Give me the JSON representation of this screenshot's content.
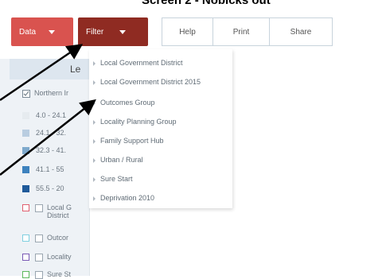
{
  "title": "Screen 2 - Noblcks out",
  "toolbar": {
    "data_label": "Data",
    "filter_label": "Filter",
    "help_label": "Help",
    "print_label": "Print",
    "share_label": "Share"
  },
  "sidebar": {
    "legend_heading": "Le",
    "items": [
      {
        "label": "Northern Ir",
        "kind": "checkbox"
      },
      {
        "label": "4.0 - 24.1",
        "kind": "swatch",
        "color": "#e6ebef"
      },
      {
        "label": "24.1 - 32.",
        "kind": "swatch",
        "color": "#b9cde0"
      },
      {
        "label": "32.3 - 41.",
        "kind": "swatch",
        "color": "#7ea9cc"
      },
      {
        "label": "41.1 - 55",
        "kind": "swatch",
        "color": "#3d82be"
      },
      {
        "label": "55.5 - 20",
        "kind": "swatch",
        "color": "#1f5a9a"
      },
      {
        "label": "Local G District",
        "kind": "boxed",
        "color": "#e06070"
      },
      {
        "label": "Outcor",
        "kind": "boxed",
        "color": "#7fd0e0"
      },
      {
        "label": "Locality",
        "kind": "boxed",
        "color": "#7b5bb5"
      },
      {
        "label": "Sure St",
        "kind": "boxed",
        "color": "#5cb85c"
      }
    ]
  },
  "filter_menu": {
    "items": [
      "Local Government District",
      "Local Government District 2015",
      "Outcomes Group",
      "Locality Planning Group",
      "Family Support Hub",
      "Urban / Rural",
      "Sure Start",
      "Deprivation 2010"
    ]
  }
}
